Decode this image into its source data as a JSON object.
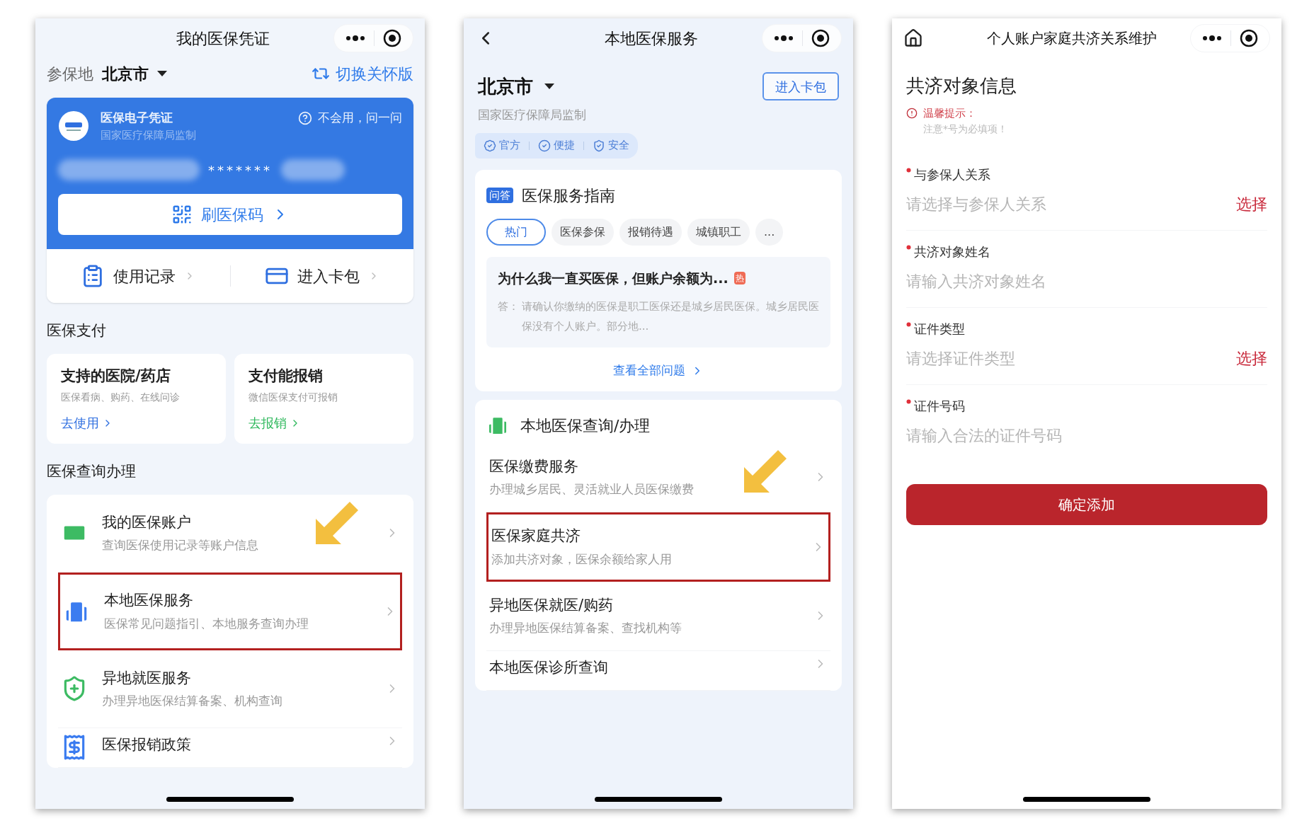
{
  "screen_credential": {
    "nav": {
      "title": "我的医保凭证"
    },
    "location": {
      "label": "参保地",
      "city": "北京市",
      "switch": "切换关怀版"
    },
    "card": {
      "title": "医保电子凭证",
      "subtitle": "国家医疗保障局监制",
      "help": "不会用，问一问",
      "masked": "*******",
      "scan": "刷医保码"
    },
    "quick_links": [
      {
        "label": "使用记录"
      },
      {
        "label": "进入卡包"
      }
    ],
    "payment": {
      "heading": "医保支付",
      "cards": [
        {
          "title": "支持的医院/药店",
          "desc": "医保看病、购药、在线问诊",
          "action": "去使用",
          "color": "#2f6fe0"
        },
        {
          "title": "支付能报销",
          "desc": "微信医保支付可报销",
          "action": "去报销",
          "color": "#2eb85c"
        }
      ]
    },
    "services": {
      "heading": "医保查询办理",
      "items": [
        {
          "title": "我的医保账户",
          "desc": "查询医保使用记录等账户信息",
          "highlighted": false,
          "arrow": true
        },
        {
          "title": "本地医保服务",
          "desc": "医保常见问题指引、本地服务查询办理",
          "highlighted": true,
          "arrow": false
        },
        {
          "title": "异地就医服务",
          "desc": "办理异地医保结算备案、机构查询",
          "highlighted": false,
          "arrow": false
        },
        {
          "title": "医保报销政策",
          "highlighted": false,
          "arrow": false
        }
      ]
    }
  },
  "screen_local_service": {
    "nav": {
      "title": "本地医保服务"
    },
    "city": "北京市",
    "subtitle": "国家医疗保障局监制",
    "wallet_button": "进入卡包",
    "badges": [
      "官方",
      "便捷",
      "安全"
    ],
    "guide": {
      "tag": "问答",
      "title": "医保服务指南",
      "tabs": [
        {
          "label": "热门",
          "selected": true
        },
        {
          "label": "医保参保",
          "selected": false
        },
        {
          "label": "报销待遇",
          "selected": false
        },
        {
          "label": "城镇职工",
          "selected": false
        },
        {
          "label": "...",
          "selected": false
        }
      ],
      "question": "为什么我一直买医保，但账户余额为...",
      "hot": "热",
      "answer_label": "答：",
      "answer": "请确认你缴纳的医保是职工医保还是城乡居民医保。城乡居民医保没有个人账户。部分地...",
      "more": "查看全部问题"
    },
    "local": {
      "heading": "本地医保查询/办理",
      "items": [
        {
          "title": "医保缴费服务",
          "desc": "办理城乡居民、灵活就业人员医保缴费",
          "highlighted": false,
          "arrow": true
        },
        {
          "title": "医保家庭共济",
          "desc": "添加共济对象，医保余额给家人用",
          "highlighted": true,
          "arrow": false
        },
        {
          "title": "异地医保就医/购药",
          "desc": "办理异地医保结算备案、查找机构等",
          "highlighted": false,
          "arrow": false
        },
        {
          "title": "本地医保诊所查询",
          "highlighted": false,
          "arrow": false
        }
      ]
    }
  },
  "screen_family_form": {
    "nav": {
      "title": "个人账户家庭共济关系维护"
    },
    "heading": "共济对象信息",
    "notice_title": "温馨提示：",
    "notice": "注意*号为必填项！",
    "fields": [
      {
        "kind": "select",
        "label": "与参保人关系",
        "placeholder": "请选择与参保人关系",
        "action": "选择",
        "required": true
      },
      {
        "kind": "text",
        "label": "共济对象姓名",
        "placeholder": "请输入共济对象姓名",
        "required": true
      },
      {
        "kind": "select",
        "label": "证件类型",
        "placeholder": "请选择证件类型",
        "action": "选择",
        "required": true
      },
      {
        "kind": "text",
        "label": "证件号码",
        "placeholder": "请输入合法的证件号码",
        "required": true
      }
    ],
    "submit": "确定添加"
  }
}
